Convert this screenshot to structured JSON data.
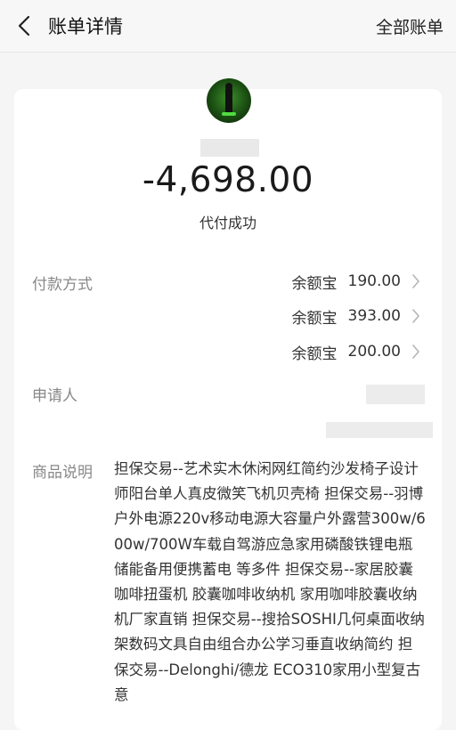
{
  "header": {
    "title": "账单详情",
    "all_bills_label": "全部账单",
    "back_icon": "chevron-left-icon"
  },
  "summary": {
    "avatar_icon": "avatar-image",
    "amount": "-4,698.00",
    "status": "代付成功"
  },
  "payment": {
    "label": "付款方式",
    "items": [
      {
        "method": "余额宝",
        "amount": "190.00"
      },
      {
        "method": "余额宝",
        "amount": "393.00"
      },
      {
        "method": "余额宝",
        "amount": "200.00"
      }
    ]
  },
  "applicant": {
    "label": "申请人"
  },
  "product": {
    "label": "商品说明",
    "description": "担保交易--艺术实木休闲网红简约沙发椅子设计师阳台单人真皮微笑飞机贝壳椅 担保交易--羽博户外电源220v移动电源大容量户外露营300w/600w/700W车载自驾游应急家用磷酸铁锂电瓶储能备用便携蓄电 等多件 担保交易--家居胶囊咖啡扭蛋机 胶囊咖啡收纳机 家用咖啡胶囊收纳机厂家直销 担保交易--搜拾SOSHI几何桌面收纳架数码文具自由组合办公学习垂直收纳简约 担保交易--Delonghi/德龙 ECO310家用小型复古意"
  },
  "colors": {
    "background": "#f5f5f5",
    "card": "#ffffff",
    "label": "#888888",
    "text": "#333333"
  }
}
